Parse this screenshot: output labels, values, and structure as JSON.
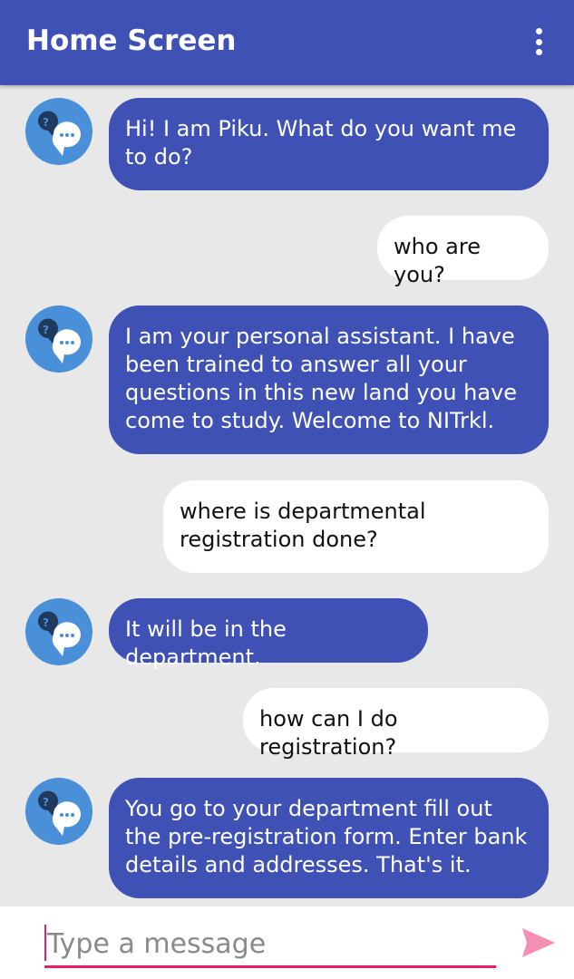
{
  "appbar": {
    "title": "Home Screen",
    "menu_icon": "more-vert-icon"
  },
  "colors": {
    "primary": "#3f51b5",
    "accent": "#e91e63",
    "avatar": "#4a90d9",
    "background": "#e8e8e8"
  },
  "messages": [
    {
      "from": "bot",
      "text": "Hi! I am Piku. What do you want me to do?"
    },
    {
      "from": "user",
      "text": "who are you?"
    },
    {
      "from": "bot",
      "text": "I am your personal assistant. I have been trained to answer all your questions in this new land you have come to study. Welcome to NITrkl."
    },
    {
      "from": "user",
      "text": "where is departmental registration done?"
    },
    {
      "from": "bot",
      "text": "It will be in the department."
    },
    {
      "from": "user",
      "text": "how can I do registration?"
    },
    {
      "from": "bot",
      "text": "You go to your department fill out the pre-registration form. Enter bank details and addresses. That's it."
    }
  ],
  "composer": {
    "placeholder": "Type a message",
    "send_icon": "send-icon"
  }
}
